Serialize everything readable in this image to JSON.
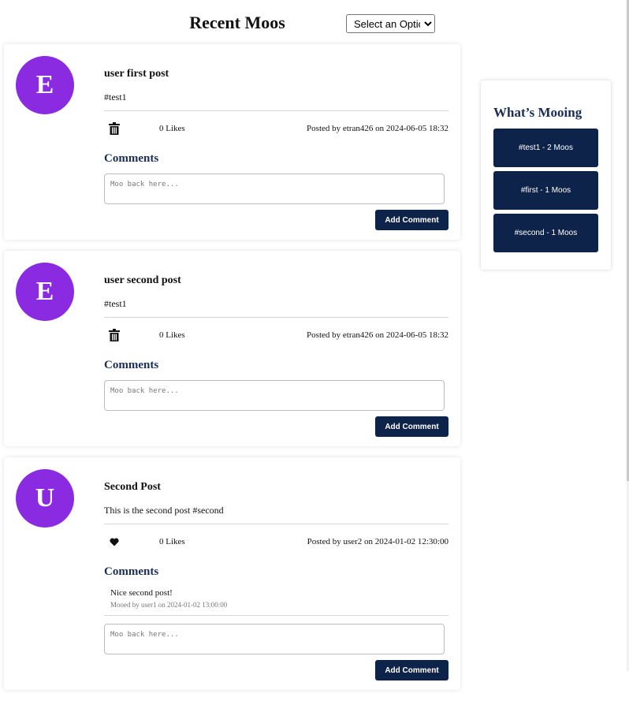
{
  "header": {
    "title": "Recent Moos",
    "sort_select": {
      "selected": "Select an Option"
    }
  },
  "posts": [
    {
      "avatar_letter": "E",
      "title": "user first post",
      "text": "#test1",
      "action_icon": "trash-icon",
      "likes": "0 Likes",
      "posted_by": "Posted by etran426 on 2024-06-05 18:32",
      "comments_title": "Comments",
      "comments": [],
      "comment_placeholder": "Moo back here...",
      "add_comment_label": "Add Comment"
    },
    {
      "avatar_letter": "E",
      "title": "user second post",
      "text": "#test1",
      "action_icon": "trash-icon",
      "likes": "0 Likes",
      "posted_by": "Posted by etran426 on 2024-06-05 18:32",
      "comments_title": "Comments",
      "comments": [],
      "comment_placeholder": "Moo back here...",
      "add_comment_label": "Add Comment"
    },
    {
      "avatar_letter": "U",
      "title": "Second Post",
      "text": "This is the second post #second",
      "action_icon": "heart-icon",
      "likes": "0 Likes",
      "posted_by": "Posted by user2 on 2024-01-02 12:30:00",
      "comments_title": "Comments",
      "comments": [
        {
          "text": "Nice second post!",
          "meta": "Mooed by user1 on 2024-01-02 13:00:00"
        }
      ],
      "comment_placeholder": "Moo back here...",
      "add_comment_label": "Add Comment"
    }
  ],
  "sidebar": {
    "title": "What’s Mooing",
    "trends": [
      {
        "label": "#test1 - 2 Moos"
      },
      {
        "label": "#first - 1 Moos"
      },
      {
        "label": "#second - 1 Moos"
      }
    ]
  },
  "colors": {
    "avatar": "#8a2be2",
    "navy_button": "#0d2349",
    "heading_blue": "#1a2e55"
  }
}
